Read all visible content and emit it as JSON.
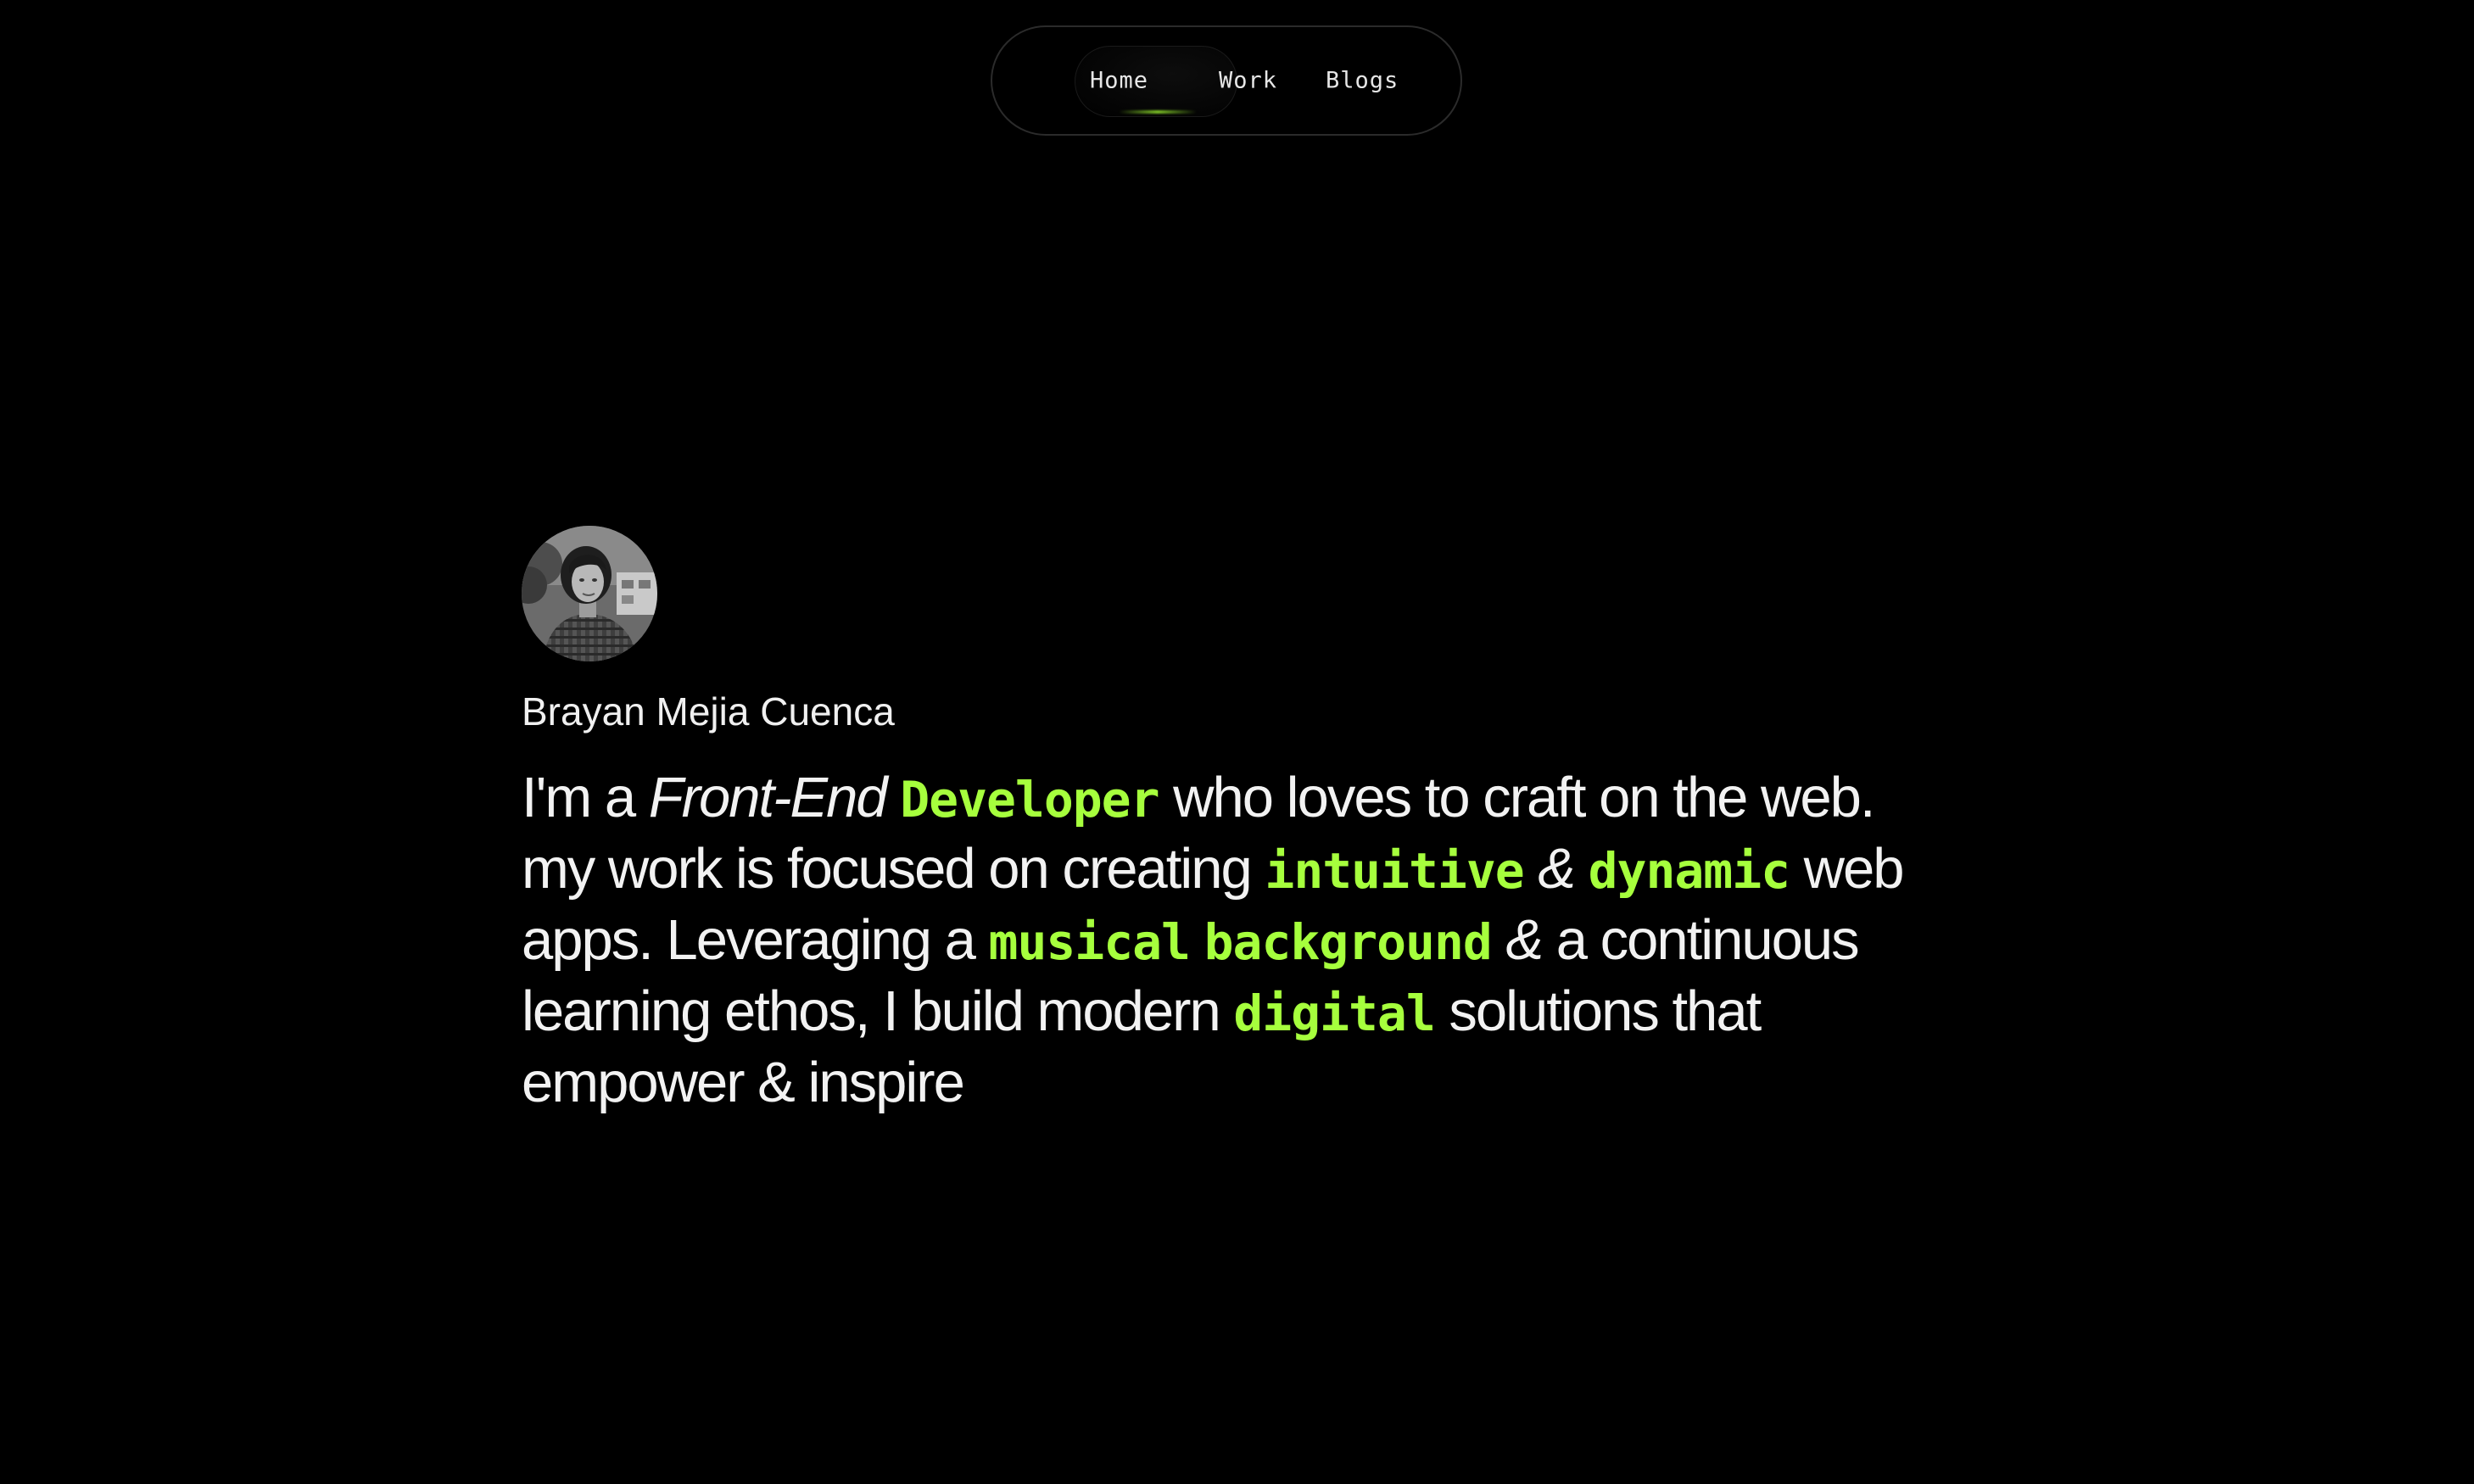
{
  "nav": {
    "items": [
      {
        "label": "Home",
        "active": true
      },
      {
        "label": "Work",
        "active": false
      },
      {
        "label": "Blogs",
        "active": false
      }
    ]
  },
  "profile": {
    "name": "Brayan Mejia Cuenca"
  },
  "bio": {
    "l1_a": "I'm a ",
    "l1_b": "Front-End",
    "l1_c": "Developer",
    "l1_d": "who loves to craft on the web.",
    "l2_a": "my work is focused on creating ",
    "l2_b": "intuitive",
    "l2_c": " & ",
    "l2_d": "dynamic",
    "l2_e": " web",
    "l3_a": "apps. Leveraging a ",
    "l3_b": "musical",
    "l3_c": "background",
    "l3_d": " & ",
    "l3_e": "a continuous",
    "l4_a": "learning ethos, I build modern ",
    "l4_b": "digital",
    "l4_c": "solutions that",
    "l5_a": "empower & inspire"
  },
  "colors": {
    "background": "#000000",
    "accent": "#a6ff3d",
    "text": "#f2f2f2"
  }
}
